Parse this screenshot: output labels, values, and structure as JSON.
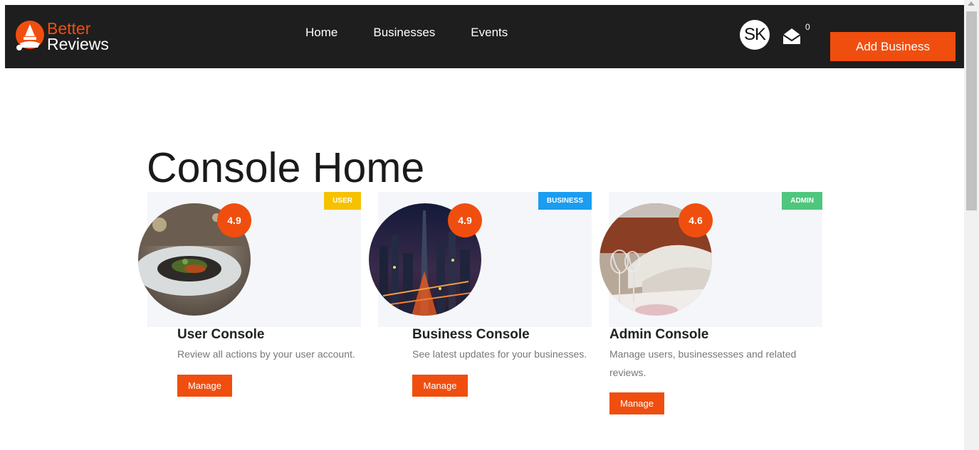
{
  "header": {
    "logo_line1": "Better",
    "logo_line2": "Reviews",
    "nav": [
      "Home",
      "Businesses",
      "Events"
    ],
    "avatar_initials": "SK",
    "mail_count": "0",
    "add_business_label": "Add Business"
  },
  "page": {
    "title": "Console Home"
  },
  "cards": [
    {
      "badge": "USER",
      "badge_color": "#f6c200",
      "rating": "4.9",
      "title": "User Console",
      "description": "Review all actions by your user account.",
      "button": "Manage",
      "image": "restaurant-plate-photo"
    },
    {
      "badge": "BUSINESS",
      "badge_color": "#1a9df0",
      "rating": "4.9",
      "title": "Business Console",
      "description": "See latest updates for your businesses.",
      "button": "Manage",
      "image": "city-night-skyline-photo"
    },
    {
      "badge": "ADMIN",
      "badge_color": "#4ec77d",
      "rating": "4.6",
      "title": "Admin Console",
      "description": "Manage users, businessesses and related reviews.",
      "button": "Manage",
      "image": "hotel-bed-wineglass-photo"
    }
  ],
  "colors": {
    "accent": "#f04e0f",
    "topbar": "#1e1e1e",
    "card_bg": "#f5f6fa"
  }
}
